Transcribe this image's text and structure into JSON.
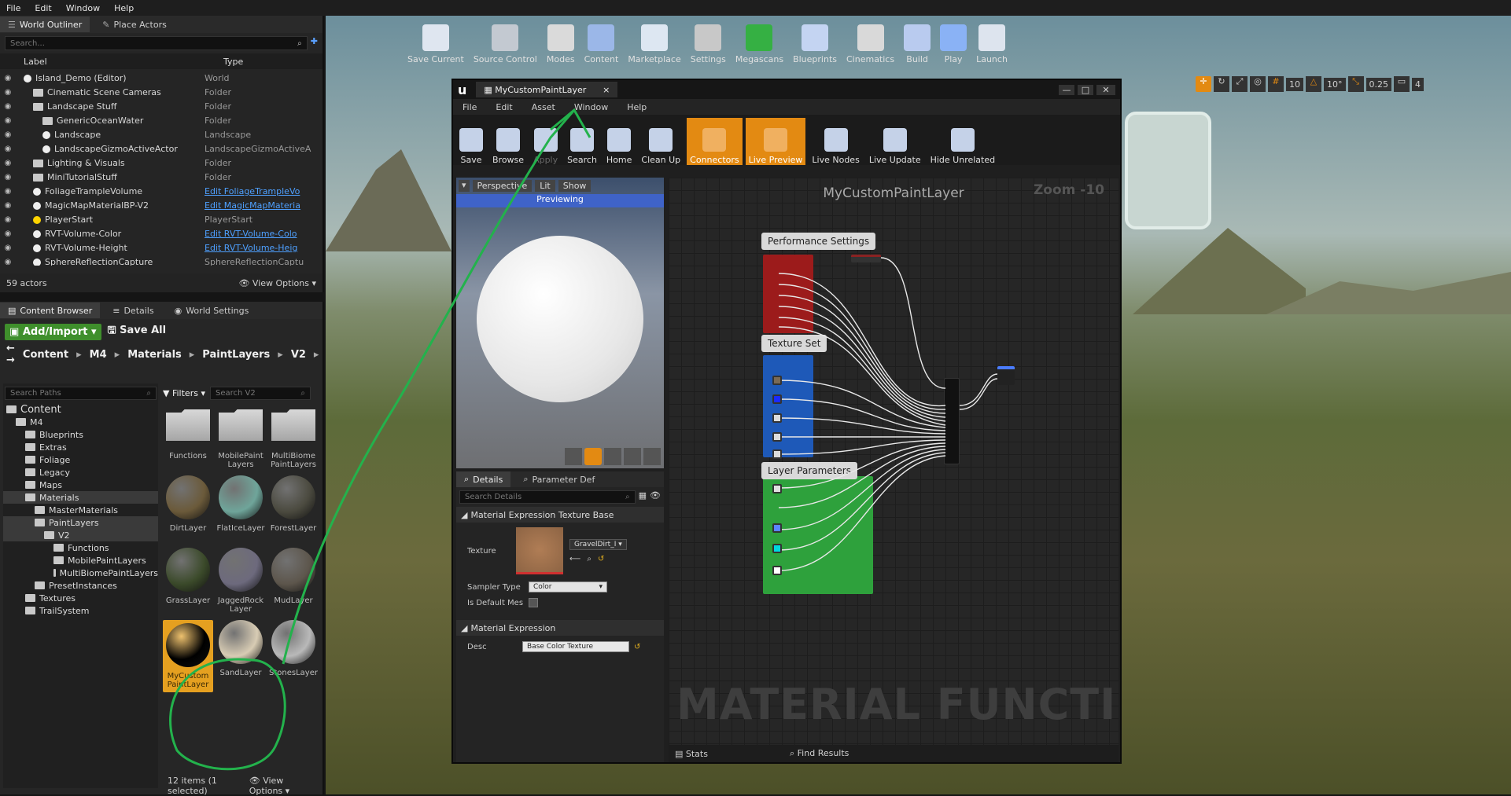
{
  "menu": [
    "File",
    "Edit",
    "Window",
    "Help"
  ],
  "outliner": {
    "tabs": [
      "World Outliner",
      "Place Actors"
    ],
    "search_placeholder": "Search...",
    "col_label": "Label",
    "col_type": "Type",
    "rows": [
      {
        "label": "Island_Demo (Editor)",
        "type": "World",
        "link": false,
        "icon": "world"
      },
      {
        "label": "Cinematic Scene Cameras",
        "type": "Folder",
        "link": false,
        "icon": "folder"
      },
      {
        "label": "Landscape Stuff",
        "type": "Folder",
        "link": false,
        "icon": "folder"
      },
      {
        "label": "GenericOceanWater",
        "type": "Folder",
        "link": false,
        "icon": "folder"
      },
      {
        "label": "Landscape",
        "type": "Landscape",
        "link": false,
        "icon": "mountain"
      },
      {
        "label": "LandscapeGizmoActiveActor",
        "type": "LandscapeGizmoActiveA",
        "link": false,
        "icon": "ball"
      },
      {
        "label": "Lighting & Visuals",
        "type": "Folder",
        "link": false,
        "icon": "folder"
      },
      {
        "label": "MiniTutorialStuff",
        "type": "Folder",
        "link": false,
        "icon": "folder"
      },
      {
        "label": "FoliageTrampleVolume",
        "type": "Edit FoliageTrampleVo",
        "link": true,
        "icon": "ball"
      },
      {
        "label": "MagicMapMaterialBP-V2",
        "type": "Edit MagicMapMateria",
        "link": true,
        "icon": "ball"
      },
      {
        "label": "PlayerStart",
        "type": "PlayerStart",
        "link": false,
        "icon": "flag"
      },
      {
        "label": "RVT-Volume-Color",
        "type": "Edit RVT-Volume-Colo",
        "link": true,
        "icon": "ball"
      },
      {
        "label": "RVT-Volume-Height",
        "type": "Edit RVT-Volume-Heig",
        "link": true,
        "icon": "ball"
      },
      {
        "label": "SphereReflectionCapture",
        "type": "SphereReflectionCaptu",
        "link": false,
        "icon": "ball"
      }
    ],
    "count": "59 actors",
    "view_options": "View Options"
  },
  "content_browser": {
    "tabs": [
      "Content Browser",
      "Details",
      "World Settings"
    ],
    "add_import": "Add/Import",
    "save_all": "Save All",
    "path": [
      "Content",
      "M4",
      "Materials",
      "PaintLayers",
      "V2"
    ],
    "search_paths": "Search Paths",
    "filters": "Filters",
    "search_v2": "Search V2",
    "tree": [
      {
        "label": "Content",
        "depth": 0
      },
      {
        "label": "M4",
        "depth": 1
      },
      {
        "label": "Blueprints",
        "depth": 2
      },
      {
        "label": "Extras",
        "depth": 2
      },
      {
        "label": "Foliage",
        "depth": 2
      },
      {
        "label": "Legacy",
        "depth": 2
      },
      {
        "label": "Maps",
        "depth": 2
      },
      {
        "label": "Materials",
        "depth": 2
      },
      {
        "label": "MasterMaterials",
        "depth": 3
      },
      {
        "label": "PaintLayers",
        "depth": 3
      },
      {
        "label": "V2",
        "depth": 4
      },
      {
        "label": "Functions",
        "depth": 5
      },
      {
        "label": "MobilePaintLayers",
        "depth": 5
      },
      {
        "label": "MultiBiomePaintLayers",
        "depth": 5
      },
      {
        "label": "PresetInstances",
        "depth": 3
      },
      {
        "label": "Textures",
        "depth": 2
      },
      {
        "label": "TrailSystem",
        "depth": 2
      }
    ],
    "assets": [
      {
        "label": "Functions",
        "kind": "folder"
      },
      {
        "label": "MobilePaint Layers",
        "kind": "folder"
      },
      {
        "label": "MultiBiome PaintLayers",
        "kind": "folder"
      },
      {
        "label": "DirtLayer",
        "kind": "ball",
        "color": "#6b5a3a"
      },
      {
        "label": "FlatIceLayer",
        "kind": "ball",
        "color": "#6fa59a"
      },
      {
        "label": "ForestLayer",
        "kind": "ball",
        "color": "#4b4a3f"
      },
      {
        "label": "GrassLayer",
        "kind": "ball",
        "color": "#3b4a2a"
      },
      {
        "label": "JaggedRock Layer",
        "kind": "ball",
        "color": "#6d6a7d"
      },
      {
        "label": "MudLayer",
        "kind": "ball",
        "color": "#5d564c"
      },
      {
        "label": "MyCustom PaintLayer",
        "kind": "ball",
        "color": "#000000"
      },
      {
        "label": "SandLayer",
        "kind": "ball",
        "color": "#d8ccb4"
      },
      {
        "label": "StonesLayer",
        "kind": "ball",
        "color": "#b9b9b9"
      }
    ],
    "status": "12 items (1 selected)",
    "view_options": "View Options"
  },
  "main_toolbar": [
    "Save Current",
    "Source Control",
    "Modes",
    "Content",
    "Marketplace",
    "Settings",
    "Megascans",
    "Blueprints",
    "Cinematics",
    "Build",
    "Play",
    "Launch"
  ],
  "viewport_stats": [
    "10",
    "10°",
    "0.25",
    "4"
  ],
  "material_editor": {
    "tab_title": "MyCustomPaintLayer",
    "menu": [
      "File",
      "Edit",
      "Asset",
      "Window",
      "Help"
    ],
    "toolbar": [
      "Save",
      "Browse",
      "Apply",
      "Search",
      "Home",
      "Clean Up",
      "Connectors",
      "Live Preview",
      "Live Nodes",
      "Live Update",
      "Hide Unrelated"
    ],
    "preview": {
      "perspective": "Perspective",
      "lit": "Lit",
      "show": "Show",
      "banner": "Previewing"
    },
    "graph_title": "MyCustomPaintLayer",
    "zoom": "Zoom -10",
    "comments": [
      "Performance Settings",
      "Texture Set",
      "Layer Parameters"
    ],
    "watermark": "MATERIAL FUNCTION",
    "details_tabs": [
      "Details",
      "Parameter Def"
    ],
    "search_details": "Search Details",
    "section1": "Material Expression Texture Base",
    "texture_label": "Texture",
    "texture_value": "GravelDirt_I",
    "sampler_label": "Sampler Type",
    "sampler_value": "Color",
    "default_label": "Is Default Mes",
    "section2": "Material Expression",
    "desc_label": "Desc",
    "desc_value": "Base Color Texture",
    "bottom_tabs": [
      "Stats",
      "Find Results"
    ]
  },
  "colors": {
    "accent": "#e38a12",
    "add_import": "#3f8f2c",
    "selection": "#e5a020",
    "annotation": "#23b24c"
  }
}
